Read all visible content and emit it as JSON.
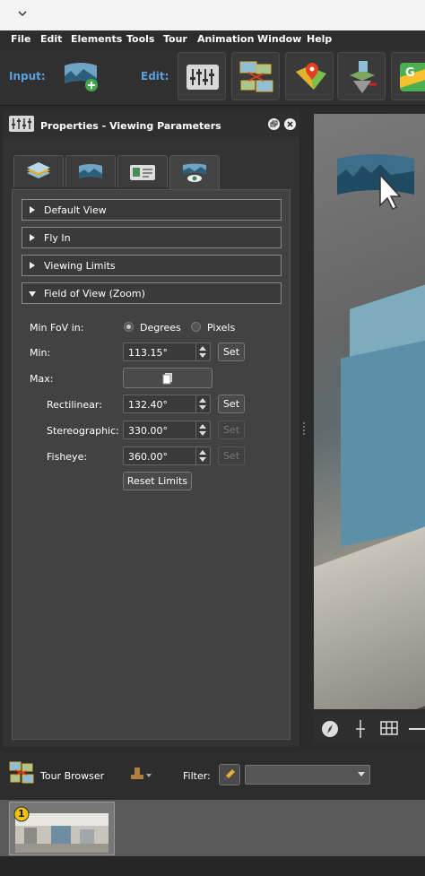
{
  "menu": [
    "File",
    "Edit",
    "Elements",
    "Tools",
    "Tour",
    "Animation",
    "Window",
    "Help"
  ],
  "toolbar": {
    "input_label": "Input:",
    "edit_label": "Edit:",
    "buttons": [
      "add-panorama-icon",
      "viewing-parameters-icon",
      "tour-links-icon",
      "map-marker-icon",
      "floorplan-icon",
      "google-maps-icon"
    ]
  },
  "panel": {
    "title": "Properties - Viewing Parameters",
    "tabs": [
      "layers-icon",
      "panorama-icon",
      "card-icon",
      "view-eye-icon"
    ],
    "sections": {
      "default_view": "Default View",
      "fly_in": "Fly In",
      "viewing_limits": "Viewing Limits",
      "field_of_view": "Field of View (Zoom)"
    },
    "fov": {
      "min_fov_in_label": "Min FoV in:",
      "degrees_label": "Degrees",
      "pixels_label": "Pixels",
      "selected_unit": "Degrees",
      "min_label": "Min:",
      "min_value": "113.15°",
      "max_label": "Max:",
      "rectilinear_label": "Rectilinear:",
      "rectilinear_value": "132.40°",
      "stereographic_label": "Stereographic:",
      "stereographic_value": "330.00°",
      "fisheye_label": "Fisheye:",
      "fisheye_value": "360.00°",
      "set_label": "Set",
      "reset_label": "Reset Limits"
    }
  },
  "tour_browser": {
    "title": "Tour Browser",
    "filter_label": "Filter:",
    "filter_value": "",
    "thumbnail_badge": "1"
  },
  "colors": {
    "accent_blue": "#5aa0e0",
    "panel_bg": "#424242",
    "badge_yellow": "#f2c300"
  }
}
